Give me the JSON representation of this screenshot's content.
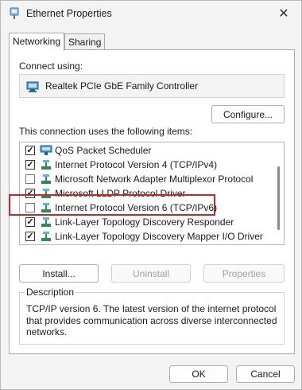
{
  "window": {
    "title": "Ethernet Properties"
  },
  "tabs": [
    {
      "label": "Networking",
      "active": true
    },
    {
      "label": "Sharing",
      "active": false
    }
  ],
  "connect_using_label": "Connect using:",
  "adapter": {
    "name": "Realtek PCIe GbE Family Controller",
    "icon": "network-adapter-icon"
  },
  "configure_label": "Configure...",
  "items_label": "This connection uses the following items:",
  "items": [
    {
      "label": "QoS Packet Scheduler",
      "checked": true,
      "icon": "qos-scheduler-icon"
    },
    {
      "label": "Internet Protocol Version 4 (TCP/IPv4)",
      "checked": true,
      "icon": "protocol-icon"
    },
    {
      "label": "Microsoft Network Adapter Multiplexor Protocol",
      "checked": false,
      "icon": "protocol-icon"
    },
    {
      "label": "Microsoft LLDP Protocol Driver",
      "checked": true,
      "icon": "protocol-icon"
    },
    {
      "label": "Internet Protocol Version 6 (TCP/IPv6)",
      "checked": false,
      "icon": "protocol-icon"
    },
    {
      "label": "Link-Layer Topology Discovery Responder",
      "checked": true,
      "icon": "protocol-icon"
    },
    {
      "label": "Link-Layer Topology Discovery Mapper I/O Driver",
      "checked": true,
      "icon": "protocol-icon"
    }
  ],
  "buttons": {
    "install": "Install...",
    "uninstall": "Uninstall",
    "properties": "Properties",
    "ok": "OK",
    "cancel": "Cancel"
  },
  "description": {
    "legend": "Description",
    "text": "TCP/IP version 6. The latest version of the internet protocol that provides communication across diverse interconnected networks."
  },
  "colors": {
    "highlight": "#c62828",
    "accent": "#2a7ab8",
    "protocol_icon": "#2e8b57"
  }
}
